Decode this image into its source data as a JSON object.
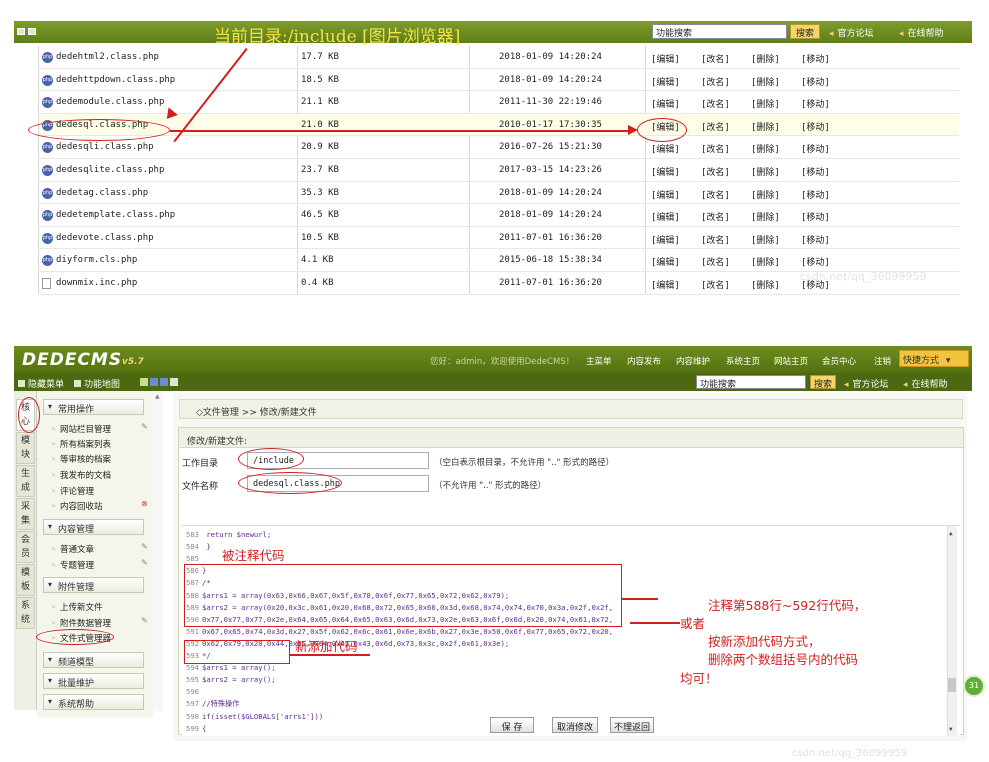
{
  "top": {
    "title": "当前目录:/include   [图片浏览器]",
    "search_placeholder": "功能搜索",
    "search_button": "搜索",
    "link_forum": "官方论坛",
    "link_help": "在线帮助",
    "files": [
      {
        "name": "dedehtml2.class.php",
        "size": "17.7 KB",
        "date": "2018-01-09 14:20:24"
      },
      {
        "name": "dedehttpdown.class.php",
        "size": "18.5 KB",
        "date": "2018-01-09 14:20:24"
      },
      {
        "name": "dedemodule.class.php",
        "size": "21.1 KB",
        "date": "2011-11-30 22:19:46"
      },
      {
        "name": "dedesql.class.php",
        "size": "21.0 KB",
        "date": "2010-01-17 17:30:35"
      },
      {
        "name": "dedesqli.class.php",
        "size": "20.9 KB",
        "date": "2016-07-26 15:21:30"
      },
      {
        "name": "dedesqlite.class.php",
        "size": "23.7 KB",
        "date": "2017-03-15 14:23:26"
      },
      {
        "name": "dedetag.class.php",
        "size": "35.3 KB",
        "date": "2018-01-09 14:20:24"
      },
      {
        "name": "dedetemplate.class.php",
        "size": "46.5 KB",
        "date": "2018-01-09 14:20:24"
      },
      {
        "name": "dedevote.class.php",
        "size": "10.5 KB",
        "date": "2011-07-01 16:36:20"
      },
      {
        "name": "diyform.cls.php",
        "size": "4.1 KB",
        "date": "2015-06-18 15:38:34"
      },
      {
        "name": "downmix.inc.php",
        "size": "0.4 KB",
        "date": "2011-07-01 16:36:20"
      }
    ],
    "actions": [
      "[编辑]",
      "[改名]",
      "[删除]",
      "[移动]"
    ],
    "watermark": "csdn.net/qq_36099959"
  },
  "cms": {
    "logo": "DEDECMS",
    "version": "v5.7",
    "nav_greeting": "您好：admin，欢迎使用DedeCMS！",
    "nav_items": [
      "主菜单",
      "内容发布",
      "内容维护",
      "系统主页",
      "网站主页",
      "会员中心",
      "注销"
    ],
    "quick_button": "快捷方式",
    "sub_left": [
      "隐藏菜单",
      "功能地图"
    ],
    "search_placeholder": "功能搜索",
    "search_button": "搜索",
    "link_forum": "官方论坛",
    "link_help": "在线帮助",
    "side_tabs": [
      "核心",
      "模块",
      "生成",
      "采集",
      "会员",
      "模板",
      "系统"
    ],
    "menu": {
      "common_head": "常用操作",
      "common_items": [
        "网站栏目管理",
        "所有档案列表",
        "等审核的档案",
        "我发布的文档",
        "评论管理",
        "内容回收站"
      ],
      "content_head": "内容管理",
      "content_items": [
        "普通文章",
        "专题管理"
      ],
      "attach_head": "附件管理",
      "attach_items": [
        "上传新文件",
        "附件数据管理",
        "文件式管理器"
      ],
      "channel_head": "频道模型",
      "batch_head": "批量维护",
      "help_head": "系统帮助"
    },
    "breadcrumb": "◇文件管理 >> 修改/新建文件",
    "panel_title": "修改/新建文件:",
    "dir_label": "工作目录",
    "dir_value": "/include",
    "dir_hint": "（空白表示根目录，不允许用 \"..\" 形式的路径）",
    "file_label": "文件名称",
    "file_value": "dedesql.class.php",
    "file_hint": "（不允许用 \"..\" 形式的路径）",
    "code_lines": [
      {
        "n": "583",
        "t": "        return $newurl;"
      },
      {
        "n": "584",
        "t": "    }"
      },
      {
        "n": "585",
        "t": ""
      },
      {
        "n": "586",
        "t": "}"
      },
      {
        "n": "587",
        "t": "/*"
      },
      {
        "n": "588",
        "t": "$arrs1 = array(0x63,0x66,0x67,0x5f,0x70,0x6f,0x77,0x65,0x72,0x62,0x79);"
      },
      {
        "n": "589",
        "t": "$arrs2 = array(0x20,0x3c,0x61,0x20,0x68,0x72,0x65,0x66,0x3d,0x68,0x74,0x74,0x70,0x3a,0x2f,0x2f,"
      },
      {
        "n": "590",
        "t": "0x77,0x77,0x77,0x2e,0x64,0x65,0x64,0x65,0x63,0x6d,0x73,0x2e,0x63,0x6f,0x6d,0x20,0x74,0x61,0x72,"
      },
      {
        "n": "591",
        "t": "0x67,0x65,0x74,0x3d,0x27,0x5f,0x62,0x6c,0x61,0x6e,0x6b,0x27,0x3e,0x50,0x6f,0x77,0x65,0x72,0x20,"
      },
      {
        "n": "592",
        "t": "0x62,0x79,0x20,0x44,0x65,0x64,0x65,0x43,0x6d,0x73,0x3c,0x2f,0x61,0x3e);"
      },
      {
        "n": "593",
        "t": "*/"
      },
      {
        "n": "594",
        "t": "$arrs1 = array();"
      },
      {
        "n": "595",
        "t": "$arrs2 = array();"
      },
      {
        "n": "596",
        "t": ""
      },
      {
        "n": "597",
        "t": "//特殊操作"
      },
      {
        "n": "598",
        "t": "if(isset($GLOBALS['arrs1']))"
      },
      {
        "n": "599",
        "t": "{"
      }
    ],
    "btn_save": "保 存",
    "btn_cancel": "取消修改",
    "btn_back": "不理返回",
    "badge": "31"
  },
  "notes": {
    "commented": "被注释代码",
    "added": "新添加代码",
    "line1": "注释第588行~592行代码，",
    "or": "或者",
    "line2": "按新添加代码方式，",
    "line3": "删除两个数组括号内的代码",
    "line4": "均可！"
  },
  "colors": {
    "accent_green": "#5f7e16",
    "annotation_red": "#d21e1e",
    "highlight_yellow": "#f5d56a"
  }
}
